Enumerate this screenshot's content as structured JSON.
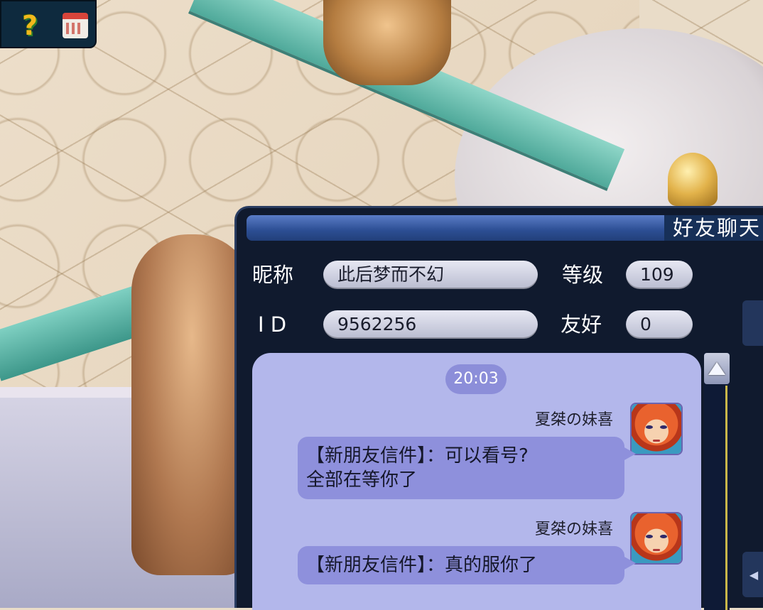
{
  "hud": {
    "quest_icon": "question-mark-person-icon",
    "calendar_icon": "calendar-icon"
  },
  "chat_window": {
    "title": "好友聊天",
    "fields": {
      "nickname_label": "昵称",
      "nickname_value": "此后梦而不幻",
      "level_label": "等级",
      "level_value": "109",
      "id_label": "I D",
      "id_value": "9562256",
      "friendship_label": "友好",
      "friendship_value": "0"
    },
    "messages": {
      "timestamp": "20:03",
      "items": [
        {
          "sender": "夏桀の妹喜",
          "line1": "【新朋友信件】：可以看号?",
          "line2": "全部在等你了"
        },
        {
          "sender": "夏桀の妹喜",
          "line1": "【新朋友信件】：真的服你了"
        }
      ]
    },
    "scroll_up_icon": "triangle-up-icon",
    "side_tab_icon": "triangle-left-icon"
  },
  "colors": {
    "window_bg": "#101a2e",
    "message_area": "#b3b7eb",
    "bubble": "#8e90dc",
    "title_bar": "#2c4e93"
  }
}
